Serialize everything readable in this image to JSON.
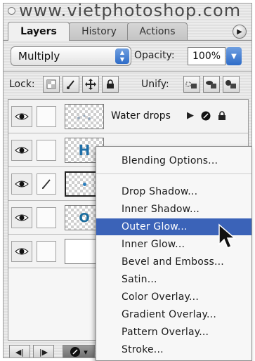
{
  "watermark": "www.vietphotoshop.com",
  "tabs": [
    {
      "label": "Layers",
      "active": true
    },
    {
      "label": "History",
      "active": false
    },
    {
      "label": "Actions",
      "active": false
    }
  ],
  "options_icon": "triangle-right-icon",
  "blend": {
    "mode": "Multiply"
  },
  "opacity": {
    "label": "Opacity:",
    "value": "100%"
  },
  "lock": {
    "label": "Lock:",
    "icons": [
      "transparency-lock-icon",
      "brush-lock-icon",
      "move-lock-icon",
      "padlock-icon"
    ]
  },
  "unify": {
    "label": "Unify:",
    "icons": [
      "unify-position-icon",
      "unify-visibility-icon",
      "unify-style-icon"
    ]
  },
  "layers": [
    {
      "name": "Water drops",
      "thumb": "checker",
      "has_fx": true,
      "linked_icon": ""
    },
    {
      "name": "",
      "thumb": "H",
      "has_fx": false,
      "linked_icon": ""
    },
    {
      "name": "",
      "thumb": "dot",
      "has_fx": false,
      "linked_icon": "brush-icon"
    },
    {
      "name": "",
      "thumb": "O",
      "has_fx": false,
      "linked_icon": ""
    },
    {
      "name": "",
      "thumb": "white",
      "has_fx": false,
      "linked_icon": ""
    }
  ],
  "menu": {
    "items": [
      {
        "label": "Blending Options...",
        "highlight": false
      },
      {
        "label": "Drop Shadow...",
        "highlight": false
      },
      {
        "label": "Inner Shadow...",
        "highlight": false
      },
      {
        "label": "Outer Glow...",
        "highlight": true
      },
      {
        "label": "Inner Glow...",
        "highlight": false
      },
      {
        "label": "Bevel and Emboss...",
        "highlight": false
      },
      {
        "label": "Satin...",
        "highlight": false
      },
      {
        "label": "Color Overlay...",
        "highlight": false
      },
      {
        "label": "Gradient Overlay...",
        "highlight": false
      },
      {
        "label": "Pattern Overlay...",
        "highlight": false
      },
      {
        "label": "Stroke...",
        "highlight": false
      }
    ]
  },
  "colors": {
    "highlight": "#3b63b8",
    "blue_control": "#2e6cc8",
    "thumb_blue": "#1f6fa8"
  }
}
